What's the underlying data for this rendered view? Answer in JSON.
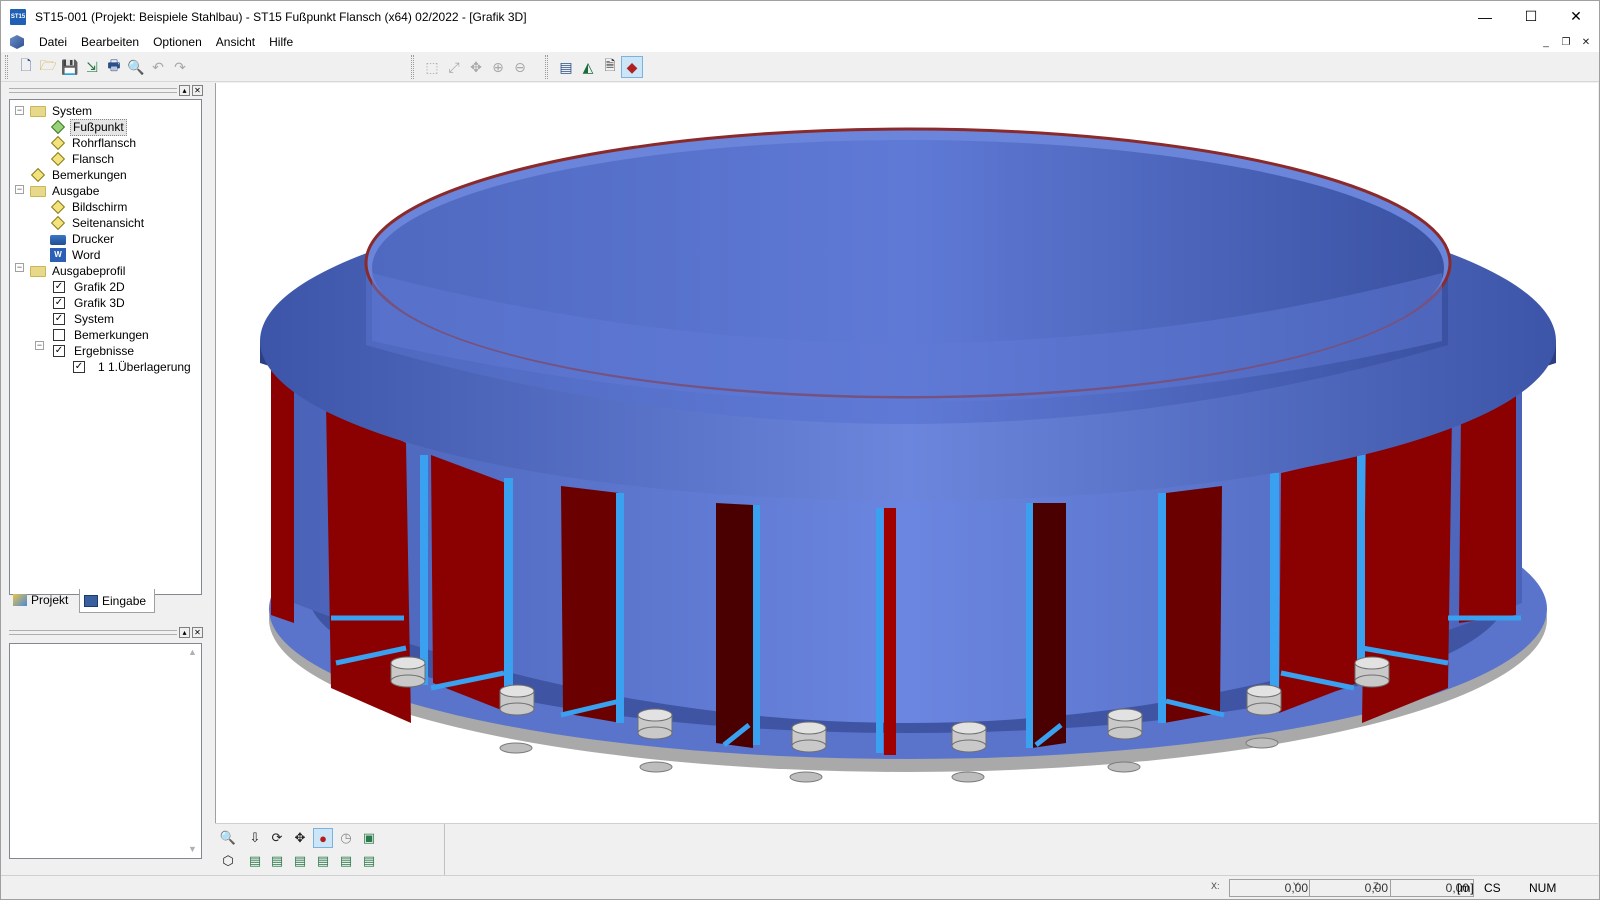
{
  "window": {
    "title": "ST15-001 (Projekt: Beispiele Stahlbau) - ST15 Fußpunkt Flansch (x64) 02/2022 - [Grafik 3D]",
    "app_icon_text": "ST15",
    "minimize": "—",
    "maximize": "☐",
    "close": "✕"
  },
  "menu": {
    "items": [
      "Datei",
      "Bearbeiten",
      "Optionen",
      "Ansicht",
      "Hilfe"
    ],
    "mdi_minimize": "_",
    "mdi_restore": "❐",
    "mdi_close": "✕"
  },
  "tree": {
    "nodes": [
      {
        "label": "System",
        "icon": "folder-icon"
      },
      {
        "label": "Fußpunkt",
        "icon": "diamond-icon",
        "selected": true
      },
      {
        "label": "Rohrflansch",
        "icon": "diamond-icon"
      },
      {
        "label": "Flansch",
        "icon": "diamond-icon"
      },
      {
        "label": "Bemerkungen",
        "icon": "diamond-icon"
      },
      {
        "label": "Ausgabe",
        "icon": "folder-icon"
      },
      {
        "label": "Bildschirm",
        "icon": "diamond-icon"
      },
      {
        "label": "Seitenansicht",
        "icon": "diamond-icon"
      },
      {
        "label": "Drucker",
        "icon": "printer-icon"
      },
      {
        "label": "Word",
        "icon": "word-icon"
      },
      {
        "label": "Ausgabeprofil",
        "icon": "folder-icon"
      },
      {
        "label": "Grafik 2D",
        "checked": true
      },
      {
        "label": "Grafik 3D",
        "checked": true
      },
      {
        "label": "System",
        "checked": true
      },
      {
        "label": "Bemerkungen",
        "checked": false
      },
      {
        "label": "Ergebnisse",
        "checked": true
      },
      {
        "label": "1 1.Überlagerung",
        "checked": true
      }
    ]
  },
  "tabs": {
    "projekt": "Projekt",
    "eingabe": "Eingabe"
  },
  "status": {
    "x_label": "X:",
    "y_label": "Y:",
    "z_label": "Z:",
    "x_value": "0,00",
    "y_value": "0,00",
    "z_value": "0,00",
    "unit": "[m]",
    "cs": "CS",
    "num": "NUM"
  },
  "colors": {
    "flange_blue": "#5a78d0",
    "rib_red": "#8b0000",
    "rib_blue": "#3aa0f0",
    "base_grey": "#c8c8c8"
  }
}
